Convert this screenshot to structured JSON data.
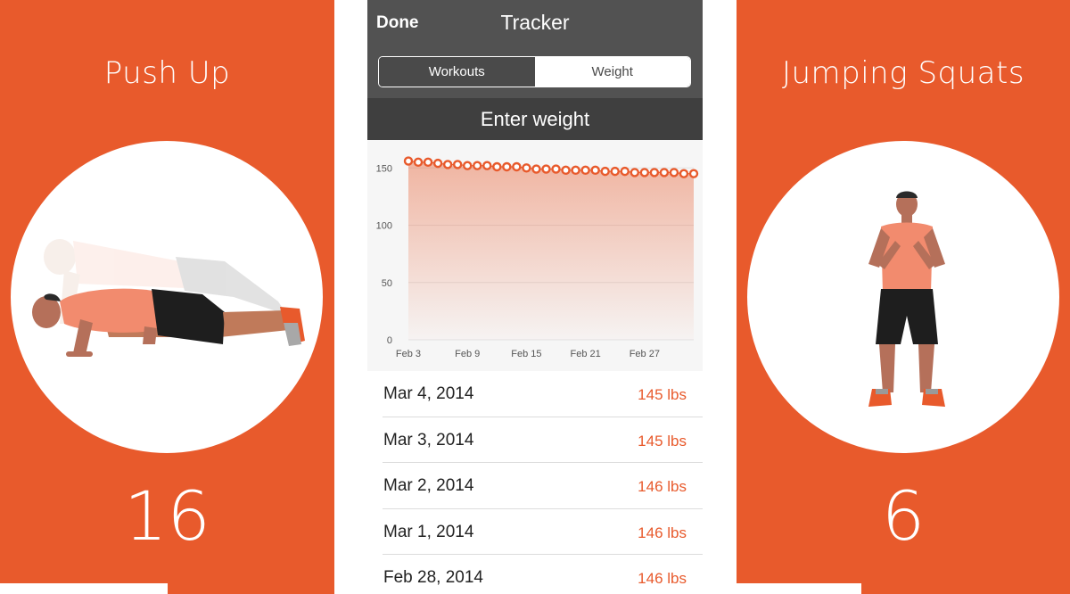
{
  "left_panel": {
    "title": "Push Up",
    "count": "16",
    "image": "push-up-figure"
  },
  "right_panel": {
    "title": "Jumping Squats",
    "count": "6",
    "image": "jumping-squats-figure"
  },
  "navbar": {
    "done_label": "Done",
    "title": "Tracker"
  },
  "segmented_control": {
    "tabs": [
      "Workouts",
      "Weight"
    ],
    "selected": "Weight"
  },
  "enter_weight_label": "Enter weight",
  "colors": {
    "accent": "#e85a2c",
    "navbar": "#525252",
    "header": "#3f3f3f"
  },
  "chart_data": {
    "type": "area",
    "title": "",
    "xlabel": "",
    "ylabel": "",
    "ylim": [
      0,
      165
    ],
    "yticks": [
      0,
      50,
      100,
      150
    ],
    "xtick_labels": [
      "Feb 3",
      "Feb 9",
      "Feb 15",
      "Feb 21",
      "Feb 27"
    ],
    "x_start": "Feb 3, 2014",
    "x_end": "Mar 4, 2014",
    "series": [
      {
        "values": [
          156,
          155,
          155,
          154,
          153,
          153,
          152,
          152,
          152,
          151,
          151,
          151,
          150,
          149,
          149,
          149,
          148,
          148,
          148,
          148,
          147,
          147,
          147,
          146,
          146,
          146,
          146,
          146,
          145,
          145
        ]
      }
    ]
  },
  "weight_log": [
    {
      "date": "Mar 4, 2014",
      "weight": "145 lbs"
    },
    {
      "date": "Mar 3, 2014",
      "weight": "145 lbs"
    },
    {
      "date": "Mar 2, 2014",
      "weight": "146 lbs"
    },
    {
      "date": "Mar 1, 2014",
      "weight": "146 lbs"
    },
    {
      "date": "Feb 28, 2014",
      "weight": "146 lbs"
    }
  ]
}
